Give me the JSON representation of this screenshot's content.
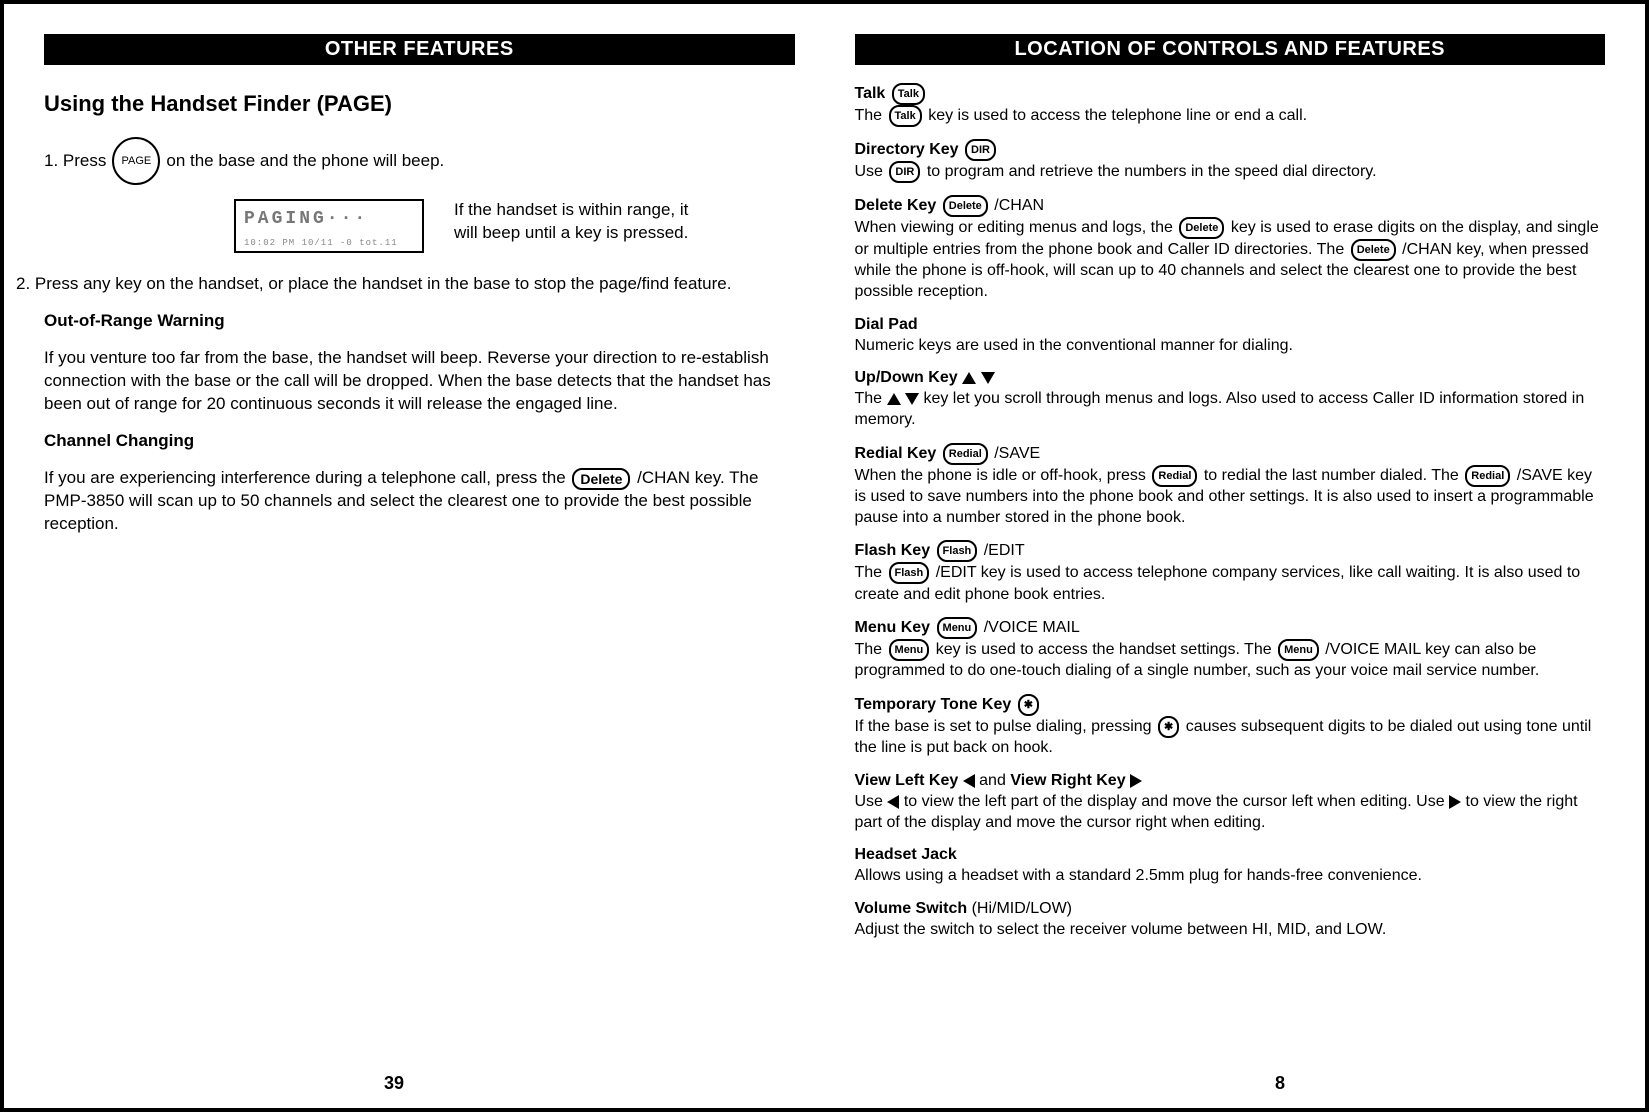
{
  "left": {
    "banner": "OTHER FEATURES",
    "h2": "Using the Handset Finder (PAGE)",
    "step1_prefix": "1.  Press",
    "page_label": "PAGE",
    "step1_suffix": "on the base and the phone will beep.",
    "lcd_line1": "PAGING···",
    "lcd_line2": "10:02 PM 10/11 -0   tot.11",
    "lcd_caption": "If the handset is within range, it will beep until a key is pressed.",
    "step2": "2.  Press any key on the handset, or place the handset in the base to stop the page/find feature.",
    "oor_head": "Out-of-Range Warning",
    "oor_body": "If you venture too far from the base, the handset will beep. Reverse your direction to re-establish connection with the base or the call will be dropped. When the base detects that the handset has been out of range for 20 continuous seconds it will release the engaged line.",
    "cc_head": "Channel Changing",
    "cc_pre": "If you are experiencing interference during a telephone call, press the",
    "delete_label": "Delete",
    "cc_post": "/CHAN key. The PMP-3850 will scan up to 50 channels and select the clearest one to provide the best possible reception.",
    "page_number": "39"
  },
  "right": {
    "banner": "LOCATION OF CONTROLS AND FEATURES",
    "talk": {
      "title": "Talk",
      "key": "Talk",
      "body_pre": "The",
      "body_post": "key is used to access the telephone line or end a call."
    },
    "dir": {
      "title": "Directory Key",
      "key": "DIR",
      "body_pre": "Use",
      "body_post": "to program and retrieve the numbers in the speed dial directory."
    },
    "del": {
      "title": "Delete Key",
      "key": "Delete",
      "suffix": "/CHAN",
      "b1_pre": "When viewing or editing menus and logs, the",
      "b1_post": "key is used to erase digits on the display, and single or multiple entries from the phone book and Caller ID directories. The",
      "b2_post": "/CHAN key, when pressed while the phone is off-hook, will scan up to 40 channels and select the clearest one to provide the best possible reception."
    },
    "dial": {
      "title": "Dial Pad",
      "body": "Numeric keys are used in the conventional manner for dialing."
    },
    "updown": {
      "title": "Up/Down Key",
      "body_pre": "The",
      "body_post": "key let you scroll through menus and logs. Also used to access Caller ID information stored in memory."
    },
    "redial": {
      "title": "Redial Key",
      "key": "Redial",
      "suffix": "/SAVE",
      "b1_pre": "When the phone is idle or off-hook, press",
      "b1_post": "to redial the last number dialed. The",
      "b2_post": "/SAVE key is used to save numbers into the phone book and other settings. It is also used to insert a programmable pause into a number stored in the phone book."
    },
    "flash": {
      "title": "Flash Key",
      "key": "Flash",
      "suffix": "/EDIT",
      "b_pre": "The",
      "b_post": "/EDIT key is used to access telephone company services, like call waiting. It is also used to create and edit phone book entries."
    },
    "menu": {
      "title": "Menu Key",
      "key": "Menu",
      "suffix": "/VOICE MAIL",
      "b_pre": "The",
      "b_mid": "key is used to access the handset settings. The",
      "b_post": "/VOICE MAIL key can also be programmed to do one-touch dialing of a single number, such as your voice mail service number."
    },
    "tone": {
      "title": "Temporary Tone Key",
      "key": "✱",
      "b_pre": "If the base is set to pulse dialing, pressing",
      "b_post": "causes subsequent digits to be dialed out using tone until the line is put back on hook."
    },
    "view": {
      "title_left": "View Left Key",
      "and": "and",
      "title_right": "View Right Key",
      "b_pre": "Use",
      "b_mid": "to view the left part of the display and move the cursor left when editing. Use",
      "b_post": "to view the right part of the display and move the cursor right when editing."
    },
    "headset": {
      "title": "Headset Jack",
      "body": "Allows using a headset with a standard 2.5mm plug for hands-free convenience."
    },
    "volume": {
      "title": "Volume Switch",
      "suffix": "(Hi/MID/LOW)",
      "body": "Adjust the switch to select the receiver volume  between HI, MID, and LOW."
    },
    "page_number": "8"
  }
}
